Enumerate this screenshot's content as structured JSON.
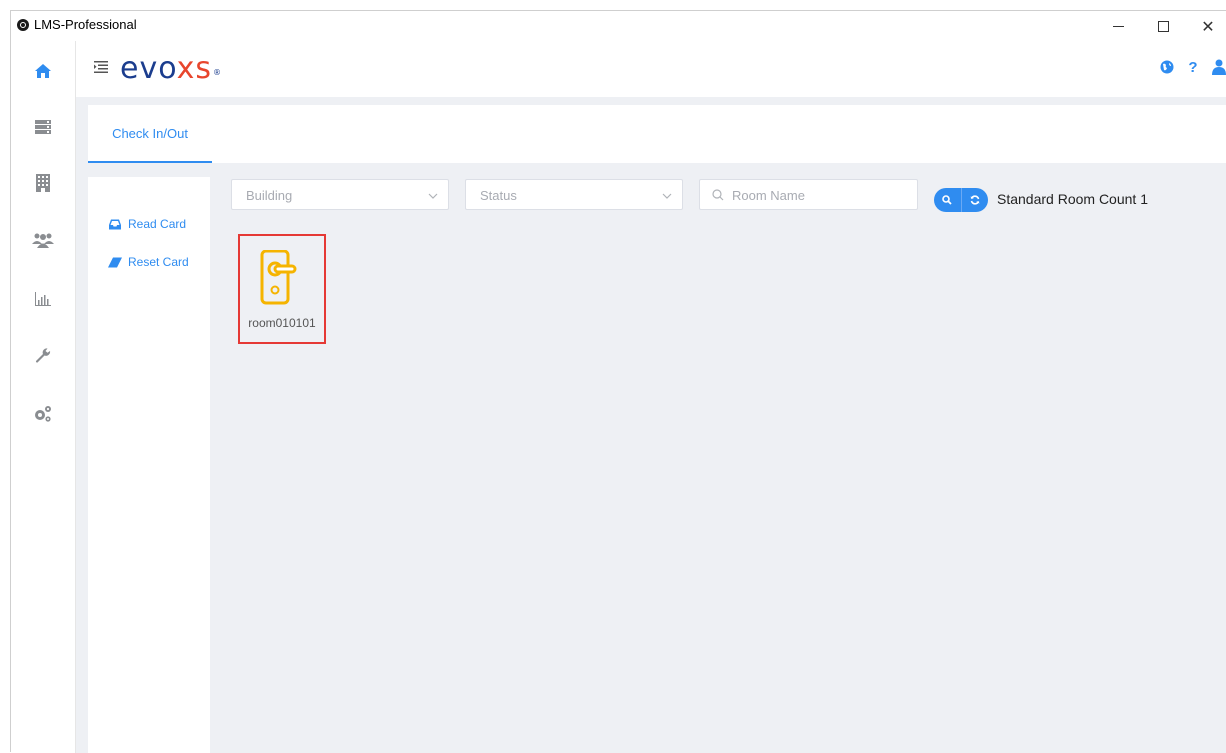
{
  "window": {
    "title": "LMS-Professional",
    "minimize_glyph": "—",
    "maximize_glyph": "☐",
    "close_glyph": "✕"
  },
  "sidebar": {
    "items": [
      {
        "icon": "home-icon",
        "active": true
      },
      {
        "icon": "server-icon"
      },
      {
        "icon": "building-icon"
      },
      {
        "icon": "users-icon"
      },
      {
        "icon": "bar-chart-icon"
      },
      {
        "icon": "wrench-icon"
      },
      {
        "icon": "settings-gears-icon"
      }
    ]
  },
  "header": {
    "logo_text_a": "evo",
    "logo_text_b": "xs",
    "logo_mark": "®",
    "icons": [
      "globe-icon",
      "help-icon",
      "user-icon"
    ],
    "help_glyph": "?"
  },
  "tabs": [
    {
      "label": "Check In/Out",
      "active": true
    }
  ],
  "left_panel": {
    "read_card": "Read Card",
    "reset_card": "Reset Card"
  },
  "filters": {
    "building_placeholder": "Building",
    "status_placeholder": "Status",
    "room_placeholder": "Room Name"
  },
  "summary": {
    "count_text": "Standard Room Count 1"
  },
  "rooms": [
    {
      "name": "room010101",
      "icon": "door-lock-icon"
    }
  ],
  "colors": {
    "accent": "#2f8cf0",
    "brand": "#1b3d8e",
    "lock": "#f5b400",
    "highlight": "#e53935",
    "content_bg": "#eef0f4"
  }
}
